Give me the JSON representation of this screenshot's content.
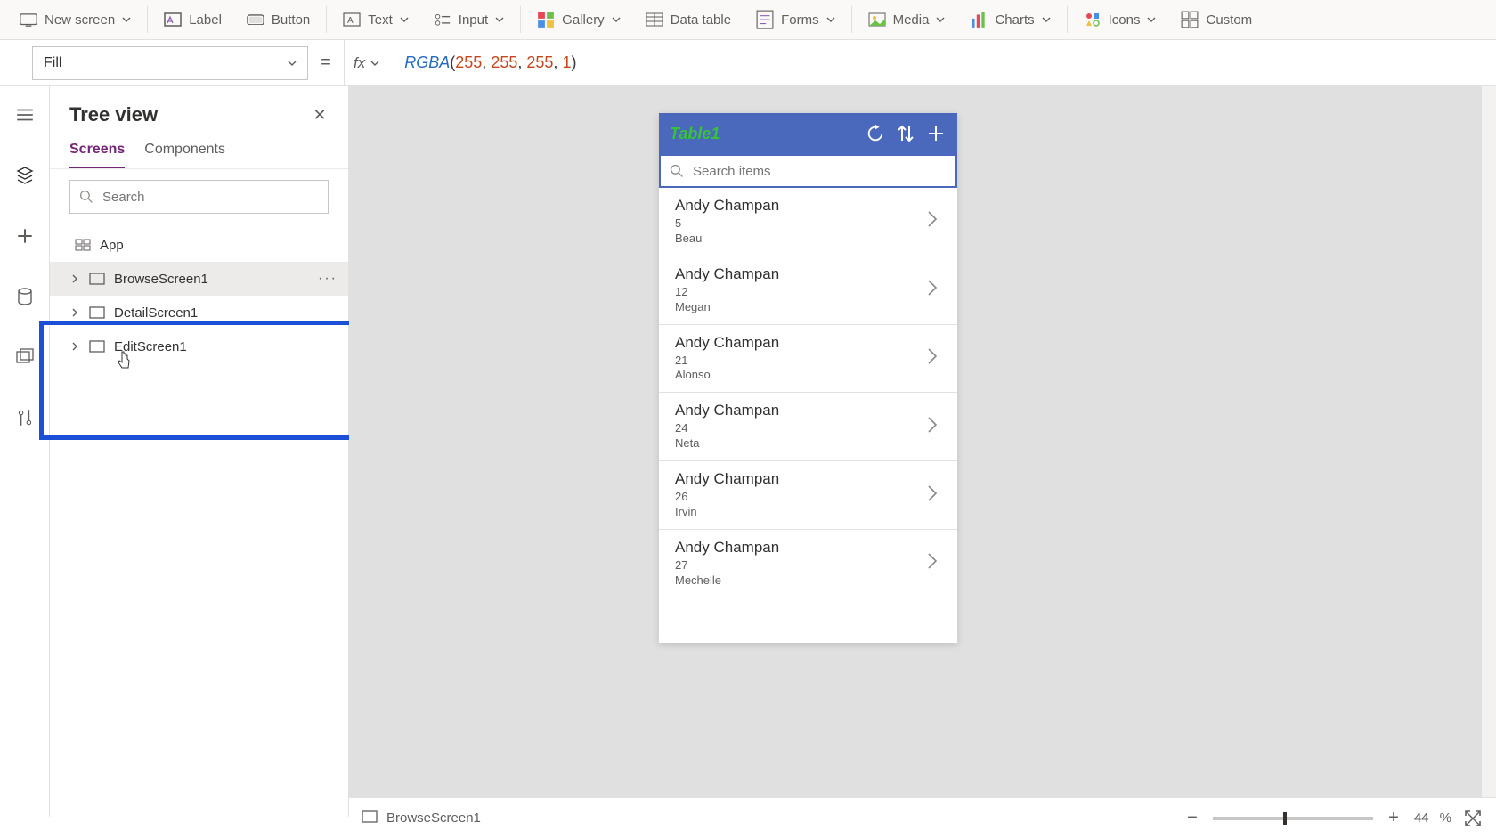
{
  "ribbon": {
    "new_screen": "New screen",
    "label": "Label",
    "button": "Button",
    "text": "Text",
    "input": "Input",
    "gallery": "Gallery",
    "data_table": "Data table",
    "forms": "Forms",
    "media": "Media",
    "charts": "Charts",
    "icons": "Icons",
    "custom": "Custom"
  },
  "property": {
    "name": "Fill",
    "fx": "fx"
  },
  "formula": {
    "fn": "RGBA",
    "a": "255",
    "b": "255",
    "c": "255",
    "d": "1"
  },
  "tree": {
    "title": "Tree view",
    "tabs": {
      "screens": "Screens",
      "components": "Components"
    },
    "search_placeholder": "Search",
    "app": "App",
    "items": [
      {
        "label": "BrowseScreen1"
      },
      {
        "label": "DetailScreen1"
      },
      {
        "label": "EditScreen1"
      }
    ],
    "more": "···"
  },
  "phone": {
    "title": "Table1",
    "search_placeholder": "Search items",
    "rows": [
      {
        "title": "Andy Champan",
        "sub1": "5",
        "sub2": "Beau"
      },
      {
        "title": "Andy Champan",
        "sub1": "12",
        "sub2": "Megan"
      },
      {
        "title": "Andy Champan",
        "sub1": "21",
        "sub2": "Alonso"
      },
      {
        "title": "Andy Champan",
        "sub1": "24",
        "sub2": "Neta"
      },
      {
        "title": "Andy Champan",
        "sub1": "26",
        "sub2": "Irvin"
      },
      {
        "title": "Andy Champan",
        "sub1": "27",
        "sub2": "Mechelle"
      }
    ]
  },
  "status": {
    "screen": "BrowseScreen1",
    "zoom_value": "44",
    "zoom_pct": "%"
  }
}
